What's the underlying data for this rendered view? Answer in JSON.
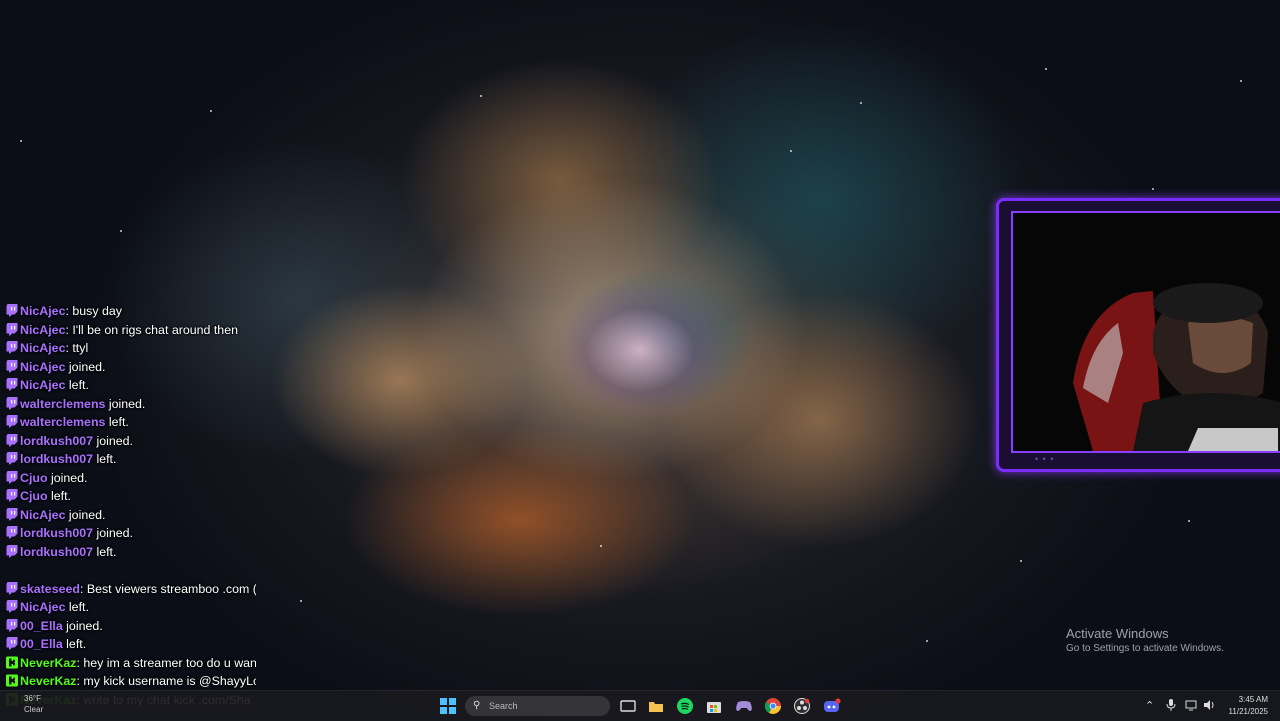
{
  "chat": {
    "messages": [
      {
        "platform": "twitch",
        "user": "NicAjec",
        "sep": ": ",
        "text": "busy day"
      },
      {
        "platform": "twitch",
        "user": "NicAjec",
        "sep": ": ",
        "text": "I'll be on rigs chat around then"
      },
      {
        "platform": "twitch",
        "user": "NicAjec",
        "sep": ": ",
        "text": "ttyl"
      },
      {
        "platform": "twitch",
        "user": "NicAjec",
        "sep": " ",
        "text": "joined."
      },
      {
        "platform": "twitch",
        "user": "NicAjec",
        "sep": " ",
        "text": "left."
      },
      {
        "platform": "twitch",
        "user": "walterclemens",
        "sep": " ",
        "text": "joined."
      },
      {
        "platform": "twitch",
        "user": "walterclemens",
        "sep": " ",
        "text": "left."
      },
      {
        "platform": "twitch",
        "user": "lordkush007",
        "sep": " ",
        "text": "joined."
      },
      {
        "platform": "twitch",
        "user": "lordkush007",
        "sep": " ",
        "text": "left."
      },
      {
        "platform": "twitch",
        "user": "Cjuo",
        "sep": " ",
        "text": "joined."
      },
      {
        "platform": "twitch",
        "user": "Cjuo",
        "sep": " ",
        "text": "left."
      },
      {
        "platform": "twitch",
        "user": "NicAjec",
        "sep": " ",
        "text": "joined."
      },
      {
        "platform": "twitch",
        "user": "lordkush007",
        "sep": " ",
        "text": "joined."
      },
      {
        "platform": "twitch",
        "user": "lordkush007",
        "sep": " ",
        "text": "left."
      },
      {
        "platform": "gap",
        "user": "",
        "sep": "",
        "text": ""
      },
      {
        "platform": "twitch",
        "user": "skateseed",
        "sep": ": ",
        "text": "Best viewers streamboo .com ("
      },
      {
        "platform": "twitch",
        "user": "NicAjec",
        "sep": " ",
        "text": "left."
      },
      {
        "platform": "twitch",
        "user": "00_Ella",
        "sep": " ",
        "text": "joined."
      },
      {
        "platform": "twitch",
        "user": "00_Ella",
        "sep": " ",
        "text": "left."
      },
      {
        "platform": "kick",
        "user": "NeverKaz",
        "sep": ": ",
        "text": "hey im a streamer too do u wan"
      },
      {
        "platform": "kick",
        "user": "NeverKaz",
        "sep": ": ",
        "text": "my kick username is @ShayyLo"
      },
      {
        "platform": "kick",
        "user": "NeverKaz",
        "sep": ": ",
        "text": "write to my chat kick .com/Sha"
      }
    ]
  },
  "watermark": {
    "line1": "Activate Windows",
    "line2": "Go to Settings to activate Windows."
  },
  "taskbar": {
    "weather_temp": "36°F",
    "weather_cond": "Clear",
    "search_placeholder": "Search",
    "clock_time": "3:45 AM",
    "clock_date": "11/21/2025",
    "icons": [
      "windows-start-icon",
      "task-view-icon",
      "file-explorer-icon",
      "spotify-icon",
      "microsoft-store-icon",
      "gaming-controller-icon",
      "chrome-icon",
      "obs-icon",
      "discord-icon"
    ]
  },
  "colors": {
    "twitch_purple": "#a970ff",
    "kick_green": "#53fc18",
    "cam_border": "#7a2cff"
  }
}
